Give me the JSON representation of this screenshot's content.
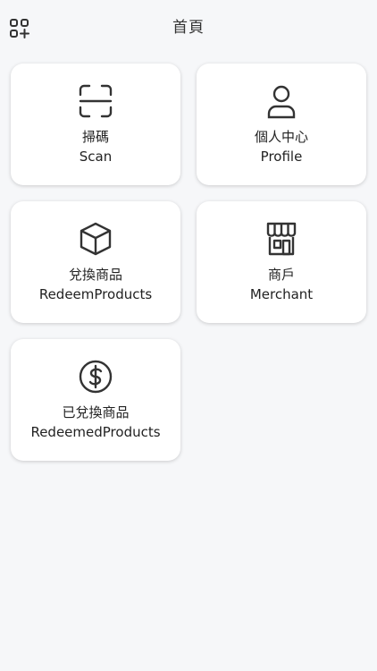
{
  "header": {
    "title": "首頁",
    "menu_icon": "grid-add-icon"
  },
  "cards": [
    {
      "zh": "掃碼",
      "en": "Scan",
      "icon": "scan-icon"
    },
    {
      "zh": "個人中心",
      "en": "Profile",
      "icon": "user-icon"
    },
    {
      "zh": "兌換商品",
      "en": "RedeemProducts",
      "icon": "box-icon"
    },
    {
      "zh": "商戶",
      "en": "Merchant",
      "icon": "store-icon"
    },
    {
      "zh": "已兌換商品",
      "en": "RedeemedProducts",
      "icon": "dollar-coin-icon"
    }
  ]
}
